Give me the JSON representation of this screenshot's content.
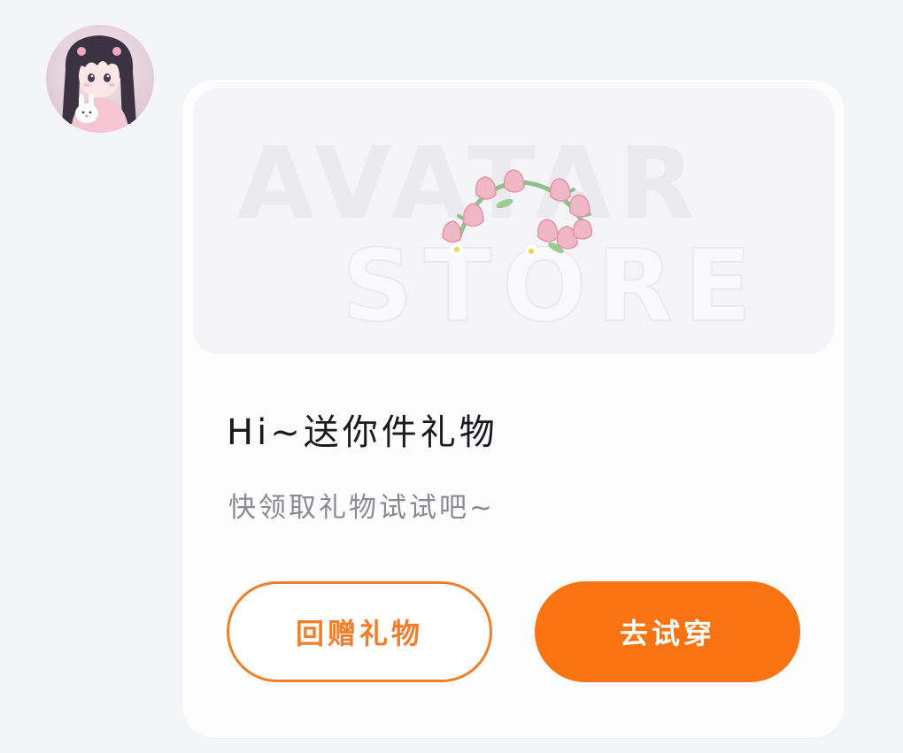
{
  "sender": {
    "avatar_icon": "anime-girl-avatar-icon"
  },
  "gift_card": {
    "banner": {
      "watermark_line1": "AVATAR",
      "watermark_line2": "STORE",
      "gift_icon": "tulip-flower-crown-icon"
    },
    "title": "Hi~送你件礼物",
    "subtitle": "快领取礼物试试吧~",
    "buttons": {
      "return_gift": "回赠礼物",
      "try_on": "去试穿"
    }
  },
  "colors": {
    "accent": "#fa7312",
    "outline": "#ef7f2a",
    "page_bg": "#f4f5f9",
    "card_bg": "#fdfdfe"
  }
}
